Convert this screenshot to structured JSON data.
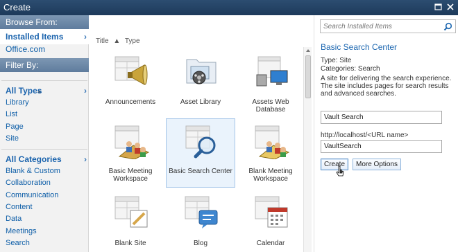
{
  "window": {
    "title": "Create"
  },
  "sidebar": {
    "browse_header": "Browse From:",
    "installed_items": "Installed Items",
    "office_com": "Office.com",
    "filter_header": "Filter By:",
    "all_types": "All Types",
    "types": [
      "Library",
      "List",
      "Page",
      "Site"
    ],
    "all_categories": "All Categories",
    "categories": [
      "Blank & Custom",
      "Collaboration",
      "Communication",
      "Content",
      "Data",
      "Meetings",
      "Search"
    ]
  },
  "sort": {
    "title": "Title",
    "type": "Type"
  },
  "tiles": [
    {
      "label": "Announcements",
      "icon": "announcements-icon"
    },
    {
      "label": "Asset Library",
      "icon": "asset-library-icon"
    },
    {
      "label": "Assets Web\nDatabase",
      "icon": "assets-web-database-icon"
    },
    {
      "label": "Basic Meeting\nWorkspace",
      "icon": "basic-meeting-workspace-icon"
    },
    {
      "label": "Basic Search Center",
      "icon": "basic-search-center-icon"
    },
    {
      "label": "Blank Meeting\nWorkspace",
      "icon": "blank-meeting-workspace-icon"
    },
    {
      "label": "Blank Site",
      "icon": "blank-site-icon"
    },
    {
      "label": "Blog",
      "icon": "blog-icon"
    },
    {
      "label": "Calendar",
      "icon": "calendar-icon"
    }
  ],
  "details": {
    "search_placeholder": "Search Installed Items",
    "title": "Basic Search Center",
    "type_line": "Type: Site",
    "category_line": "Categories: Search",
    "description": "A site for delivering the search experience. The site includes pages for search results and advanced searches.",
    "name_value": "Vault Search",
    "url_hint": "http://localhost/<URL name>",
    "url_value": "VaultSearch",
    "create_button": "Create",
    "more_options_button": "More Options"
  },
  "colors": {
    "accent": "#1b66b0",
    "title_bar": "#1d3a5b",
    "selected_tile": "#eaf3fc"
  }
}
